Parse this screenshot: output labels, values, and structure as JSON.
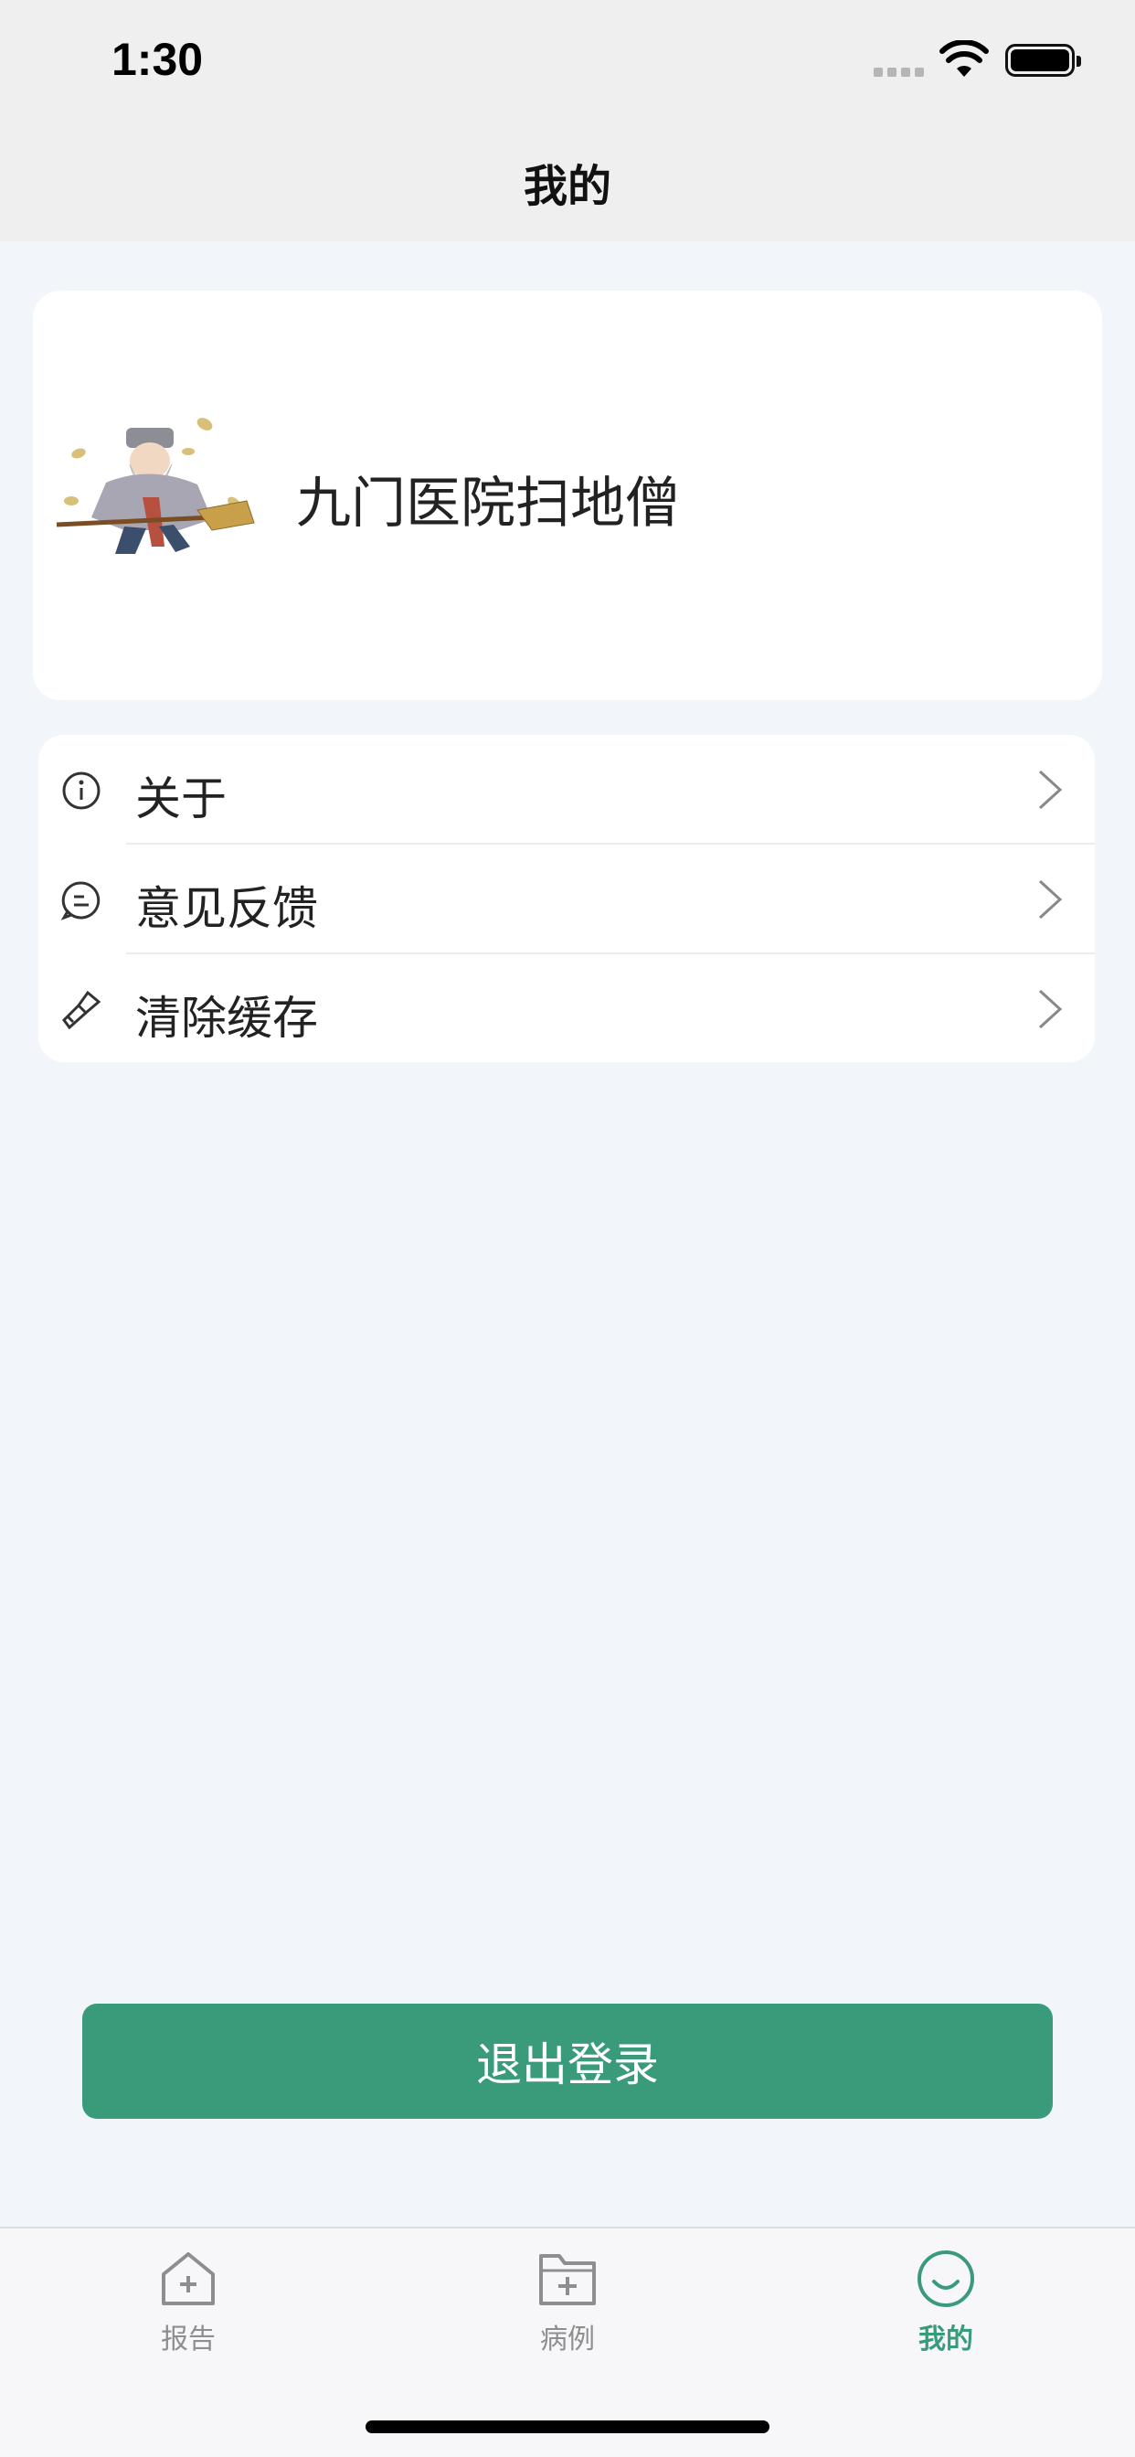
{
  "status_bar": {
    "time": "1:30"
  },
  "nav": {
    "title": "我的"
  },
  "profile": {
    "name": "九门医院扫地僧",
    "avatar_icon": "sweeping-monk-avatar"
  },
  "menu": {
    "items": [
      {
        "label": "关于",
        "icon": "info-icon"
      },
      {
        "label": "意见反馈",
        "icon": "feedback-icon"
      },
      {
        "label": "清除缓存",
        "icon": "brush-icon"
      }
    ]
  },
  "logout": {
    "label": "退出登录",
    "color": "#3a9b7b"
  },
  "tabbar": {
    "tabs": [
      {
        "label": "报告",
        "icon": "home-plus-icon",
        "active": false
      },
      {
        "label": "病例",
        "icon": "folder-plus-icon",
        "active": false
      },
      {
        "label": "我的",
        "icon": "smile-icon",
        "active": true
      }
    ],
    "active_color": "#3a9b7b",
    "inactive_color": "#8e8e8e"
  }
}
